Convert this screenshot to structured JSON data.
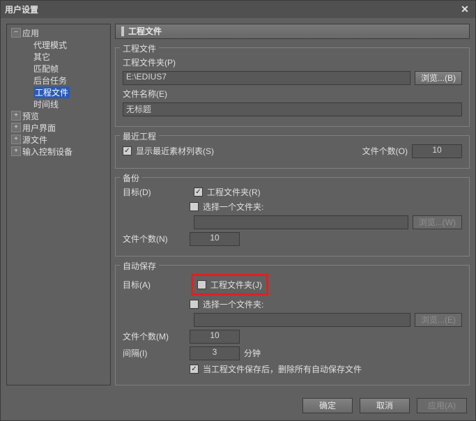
{
  "title": "用户设置",
  "tree": {
    "app": "应用",
    "proxy": "代理模式",
    "other": "其它",
    "match": "匹配帧",
    "bgTask": "后台任务",
    "project": "工程文件",
    "timeline": "时间线",
    "preview": "预览",
    "ui": "用户界面",
    "source": "源文件",
    "input": "输入控制设备"
  },
  "header": "工程文件",
  "sec1": {
    "title": "工程文件",
    "folderLabel": "工程文件夹(P)",
    "folderValue": "E:\\EDIUS7",
    "browse": "浏览...(B)",
    "nameLabel": "文件名称(E)",
    "nameValue": "无标题"
  },
  "sec2": {
    "title": "最近工程",
    "showRecent": "显示最近素材列表(S)",
    "countLabel": "文件个数(O)",
    "countValue": "10"
  },
  "sec3": {
    "title": "备份",
    "targetLabel": "目标(D)",
    "chkFolder": "工程文件夹(R)",
    "chkSelect": "选择一个文件夹:",
    "browse": "浏览...(W)",
    "countLabel": "文件个数(N)",
    "countValue": "10"
  },
  "sec4": {
    "title": "自动保存",
    "targetLabel": "目标(A)",
    "chkFolder": "工程文件夹(J)",
    "chkSelect": "选择一个文件夹:",
    "browse": "浏览...(E)",
    "countLabel": "文件个数(M)",
    "countValue": "10",
    "intervalLabel": "间隔(I)",
    "intervalValue": "3",
    "intervalUnit": "分钟",
    "chkDelete": "当工程文件保存后，删除所有自动保存文件"
  },
  "footer": {
    "ok": "确定",
    "cancel": "取消",
    "apply": "应用(A)"
  }
}
